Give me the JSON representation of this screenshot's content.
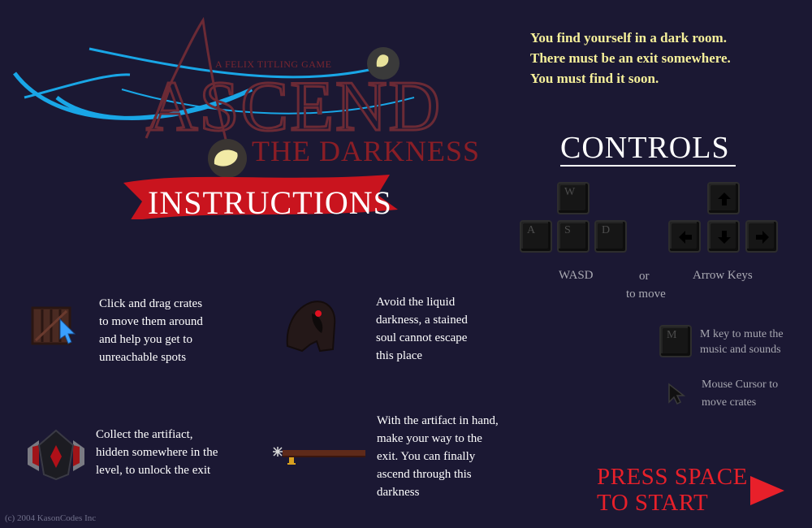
{
  "logo": {
    "tagline": "A FELIX TITLING GAME",
    "title": "ASCEND",
    "subtitle": "THE DARKNESS",
    "banner": "INSTRUCTIONS"
  },
  "story": {
    "lines": [
      "You find yourself in a dark room.",
      "There must be an exit somewhere.",
      "You must find it soon."
    ]
  },
  "controls": {
    "title": "CONTROLS",
    "keys": {
      "w": "W",
      "a": "A",
      "s": "S",
      "d": "D",
      "m": "M"
    },
    "wasd_label": "WASD",
    "or_label": "or",
    "to_move_label": "to move",
    "arrows_label": "Arrow Keys",
    "mute_lines": [
      "M key to mute the",
      "music and sounds"
    ],
    "cursor_lines": [
      "Mouse Cursor to",
      "move crates"
    ]
  },
  "instructions": {
    "crates": [
      "Click and drag crates",
      "to move them around",
      "and help you get to",
      "unreachable spots"
    ],
    "darkness": [
      "Avoid the liquid",
      "darkness, a stained",
      "soul cannot escape",
      "this place"
    ],
    "artifact": [
      "Collect the artifiact,",
      "hidden somewhere in the",
      "level, to unlock the exit"
    ],
    "exit": [
      "With the artifact in hand,",
      "make your way to the",
      "exit. You can finally",
      "ascend through this",
      "darkness"
    ]
  },
  "start": {
    "lines": [
      "PRESS SPACE",
      "TO START"
    ]
  },
  "footer": {
    "copyright": "(c) 2004 KasonCodes Inc"
  },
  "colors": {
    "background": "#1b1833",
    "story_text": "#f6f09a",
    "press_start": "#e8202a",
    "banner_red": "#c9141e",
    "swoosh_blue": "#19a6e6"
  }
}
